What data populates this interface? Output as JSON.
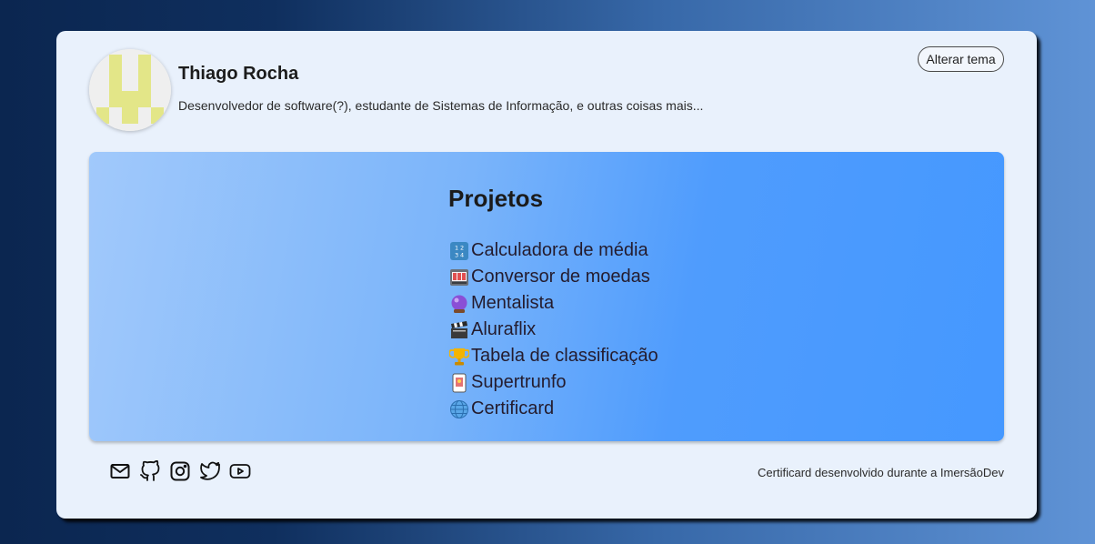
{
  "profile": {
    "name": "Thiago Rocha",
    "bio": "Desenvolvedor de software(?), estudante de Sistemas de Informação, e outras coisas mais...",
    "avatar_icon": "pixel-avatar-icon"
  },
  "theme_button": {
    "label": "Alterar tema"
  },
  "projects": {
    "title": "Projetos",
    "items": [
      {
        "label": "Calculadora de média",
        "icon": "numbers-icon"
      },
      {
        "label": "Conversor de moedas",
        "icon": "slot-machine-icon"
      },
      {
        "label": "Mentalista",
        "icon": "crystal-ball-icon"
      },
      {
        "label": "Aluraflix",
        "icon": "clapper-icon"
      },
      {
        "label": "Tabela de classificação",
        "icon": "trophy-icon"
      },
      {
        "label": "Supertrunfo",
        "icon": "playing-card-icon"
      },
      {
        "label": "Certificard",
        "icon": "globe-icon"
      }
    ]
  },
  "socials": [
    "mail-icon",
    "github-icon",
    "instagram-icon",
    "twitter-icon",
    "youtube-icon"
  ],
  "footer": {
    "text": "Certificard desenvolvido durante a ImersãoDev"
  },
  "colors": {
    "card_bg": "#e9f1fc",
    "projects_gradient_start": "#a1c9fb",
    "projects_gradient_end": "#4598ff",
    "avatar_yellow": "#e3e688"
  }
}
